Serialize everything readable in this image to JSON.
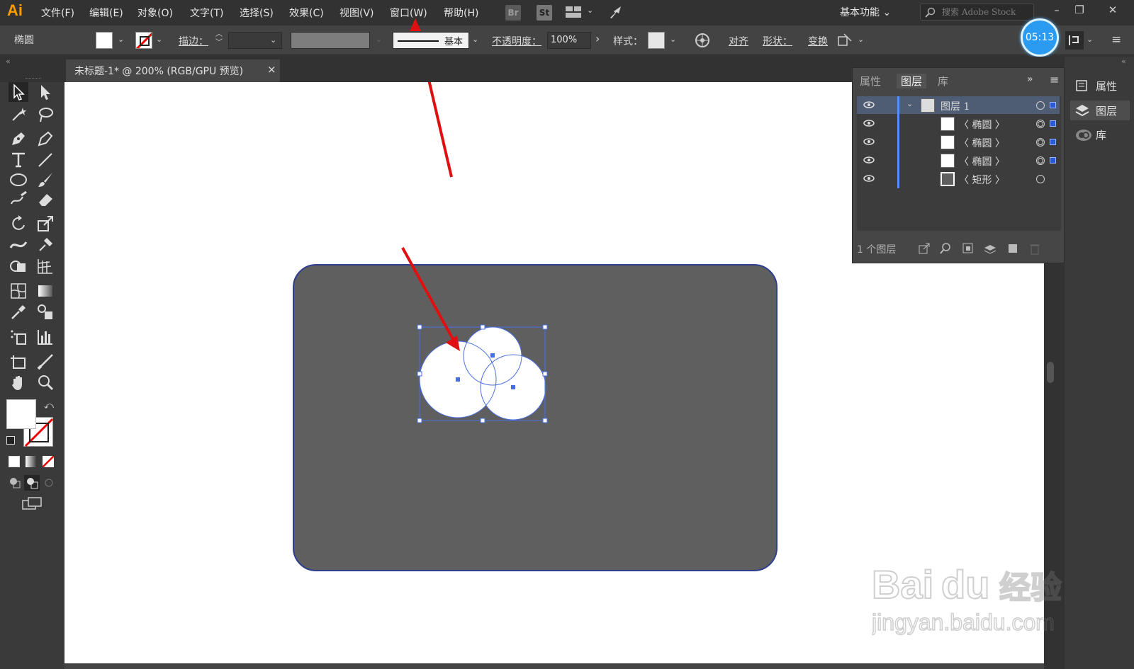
{
  "app": {
    "logo": "Ai"
  },
  "menu": {
    "items": [
      "文件(F)",
      "编辑(E)",
      "对象(O)",
      "文字(T)",
      "选择(S)",
      "效果(C)",
      "视图(V)",
      "窗口(W)",
      "帮助(H)"
    ],
    "badges": [
      "Br",
      "St"
    ],
    "workspace": "基本功能",
    "search_placeholder": "搜索 Adobe Stock"
  },
  "window_controls": {
    "minimize": "–",
    "restore": "❐",
    "close": "✕"
  },
  "control_bar": {
    "object_type": "椭圆",
    "stroke_label": "描边：",
    "stroke_style": "基本",
    "opacity_label": "不透明度：",
    "opacity_value": "100%",
    "style_label": "样式：",
    "align_label": "对齐",
    "shape_label": "形状：",
    "transform_label": "变换",
    "fill_color": "#ffffff",
    "style_swatch": "#e6e6e6"
  },
  "document": {
    "tab_title": "未标题-1* @ 200% (RGB/GPU 预览)",
    "tab_close": "×"
  },
  "artwork": {
    "rect_fill": "#5f5f5f",
    "rect_stroke": "#2f3f8f",
    "circle_fill": "#ffffff",
    "selection_color": "#4a6fe0",
    "arrow_color": "#e01010"
  },
  "layers_panel": {
    "tabs": [
      "属性",
      "图层",
      "库"
    ],
    "active_tab": "图层",
    "rows": [
      {
        "name": "图层 1",
        "type": "layer"
      },
      {
        "name": "〈 椭圆 〉",
        "type": "ellipse"
      },
      {
        "name": "〈 椭圆 〉",
        "type": "ellipse"
      },
      {
        "name": "〈 椭圆 〉",
        "type": "ellipse"
      },
      {
        "name": "〈 矩形 〉",
        "type": "rect"
      }
    ],
    "footer_count": "1 个图层"
  },
  "right_dock": {
    "items": [
      {
        "label": "属性",
        "icon": "properties-icon"
      },
      {
        "label": "图层",
        "icon": "layers-icon"
      },
      {
        "label": "库",
        "icon": "libraries-icon"
      }
    ]
  },
  "timer": "05:13",
  "watermark": {
    "brand": "Bai",
    "brand2": "du",
    "cn": "经验",
    "url": "jingyan.baidu.com"
  }
}
